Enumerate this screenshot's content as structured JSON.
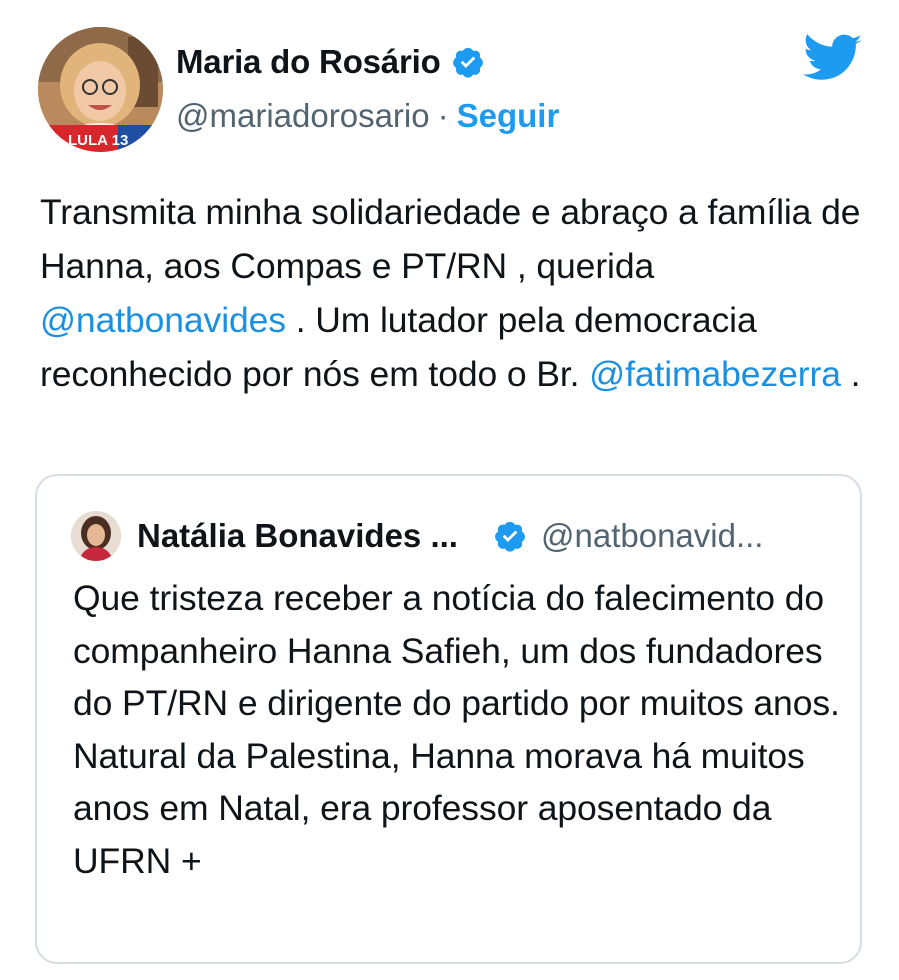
{
  "tweet": {
    "author_name": "Maria do Rosário",
    "handle": "@mariadorosario",
    "separator": "·",
    "follow_label": "Seguir",
    "avatar_badge": "LULA 13",
    "text_part1": "Transmita minha solidariedade e abraço a família de Hanna, aos Compas e PT/RN , querida ",
    "mention1": "@natbonavides",
    "text_part2": " . Um lutador pela democracia reconhecido por nós em todo o Br. ",
    "mention2": "@fatimabezerra",
    "text_part3": " ."
  },
  "quoted_tweet": {
    "author_name": "Natália Bonavides ...",
    "handle": "@natbonavid...",
    "text": "Que tristeza receber a notícia do falecimento do companheiro Hanna Safieh, um dos fundadores do PT/RN e dirigente do partido por muitos anos. Natural da Palestina, Hanna morava há muitos anos em Natal, era professor aposentado da UFRN +"
  },
  "colors": {
    "accent": "#1d9bf0",
    "text": "#0f1419",
    "secondary": "#536471",
    "border": "#d6dde3"
  },
  "icons": {
    "verified": "verified-badge-icon",
    "brand": "twitter-bird-icon"
  }
}
